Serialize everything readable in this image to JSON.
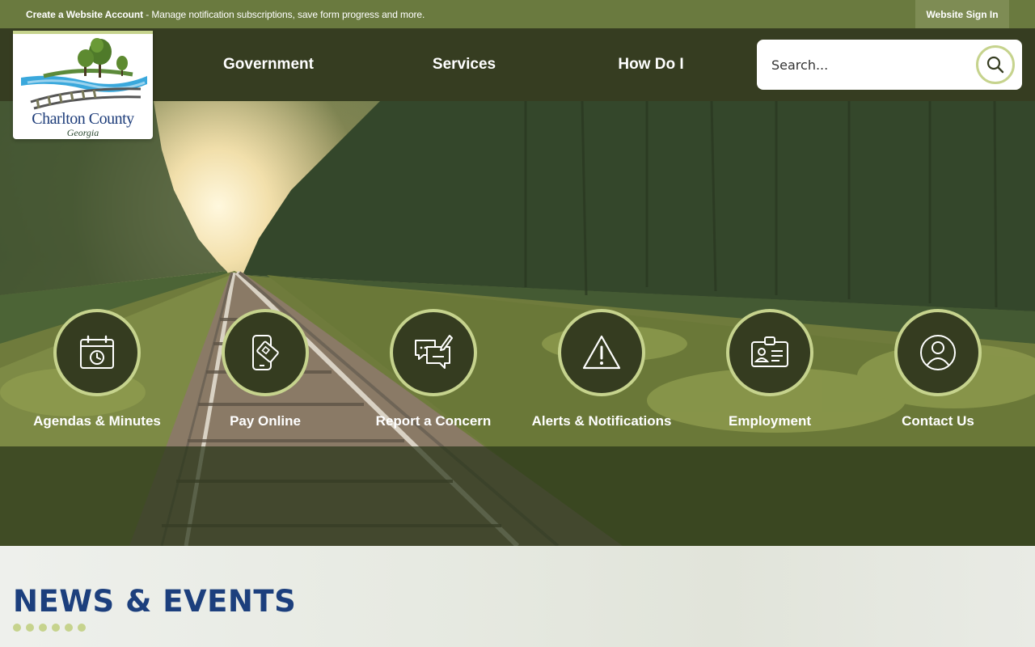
{
  "topbar": {
    "create_account": "Create a Website Account",
    "create_account_desc": " - Manage notification subscriptions, save form progress and more.",
    "sign_in": "Website Sign In"
  },
  "logo": {
    "name": "Charlton County",
    "state": "Georgia"
  },
  "nav": {
    "items": [
      "Government",
      "Services",
      "How Do I"
    ]
  },
  "search": {
    "placeholder": "Search..."
  },
  "quick_links": [
    {
      "label": "Agendas & Minutes",
      "icon": "calendar-clock-icon"
    },
    {
      "label": "Pay Online",
      "icon": "phone-payment-icon"
    },
    {
      "label": "Report a Concern",
      "icon": "chat-edit-icon"
    },
    {
      "label": "Alerts & Notifications",
      "icon": "warning-icon"
    },
    {
      "label": "Employment",
      "icon": "id-badge-icon"
    },
    {
      "label": "Contact Us",
      "icon": "user-circle-icon"
    }
  ],
  "news": {
    "title": "NEWS & EVENTS"
  },
  "colors": {
    "dark_green": "#363d21",
    "top_green": "#6a7a3f",
    "accent": "#c6d38d",
    "heading_blue": "#1c3f7d"
  }
}
